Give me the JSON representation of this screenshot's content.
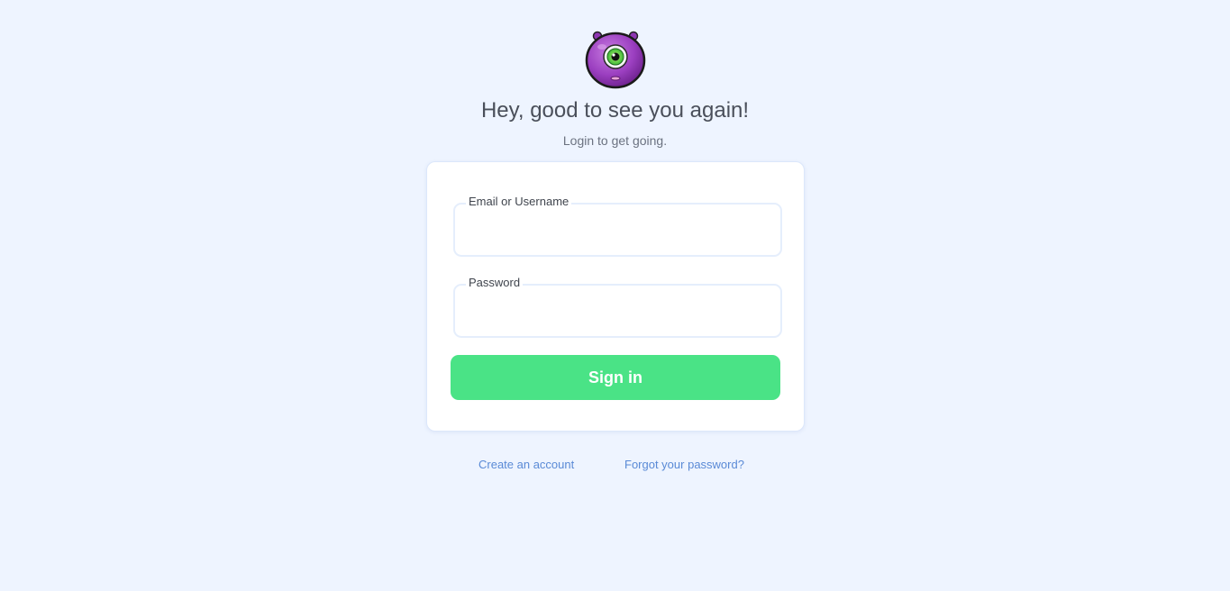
{
  "header": {
    "logo_icon": "purple-one-eyed-monster-icon",
    "title": "Hey, good to see you again!",
    "subtitle": "Login to get going."
  },
  "form": {
    "email": {
      "label": "Email or Username",
      "value": "",
      "placeholder": ""
    },
    "password": {
      "label": "Password",
      "value": "",
      "placeholder": ""
    },
    "submit_label": "Sign in"
  },
  "links": {
    "create_account": "Create an account",
    "forgot_password": "Forgot your password?"
  },
  "colors": {
    "background": "#eef4ff",
    "accent_button": "#4ae386",
    "link": "#5a8ad6"
  }
}
